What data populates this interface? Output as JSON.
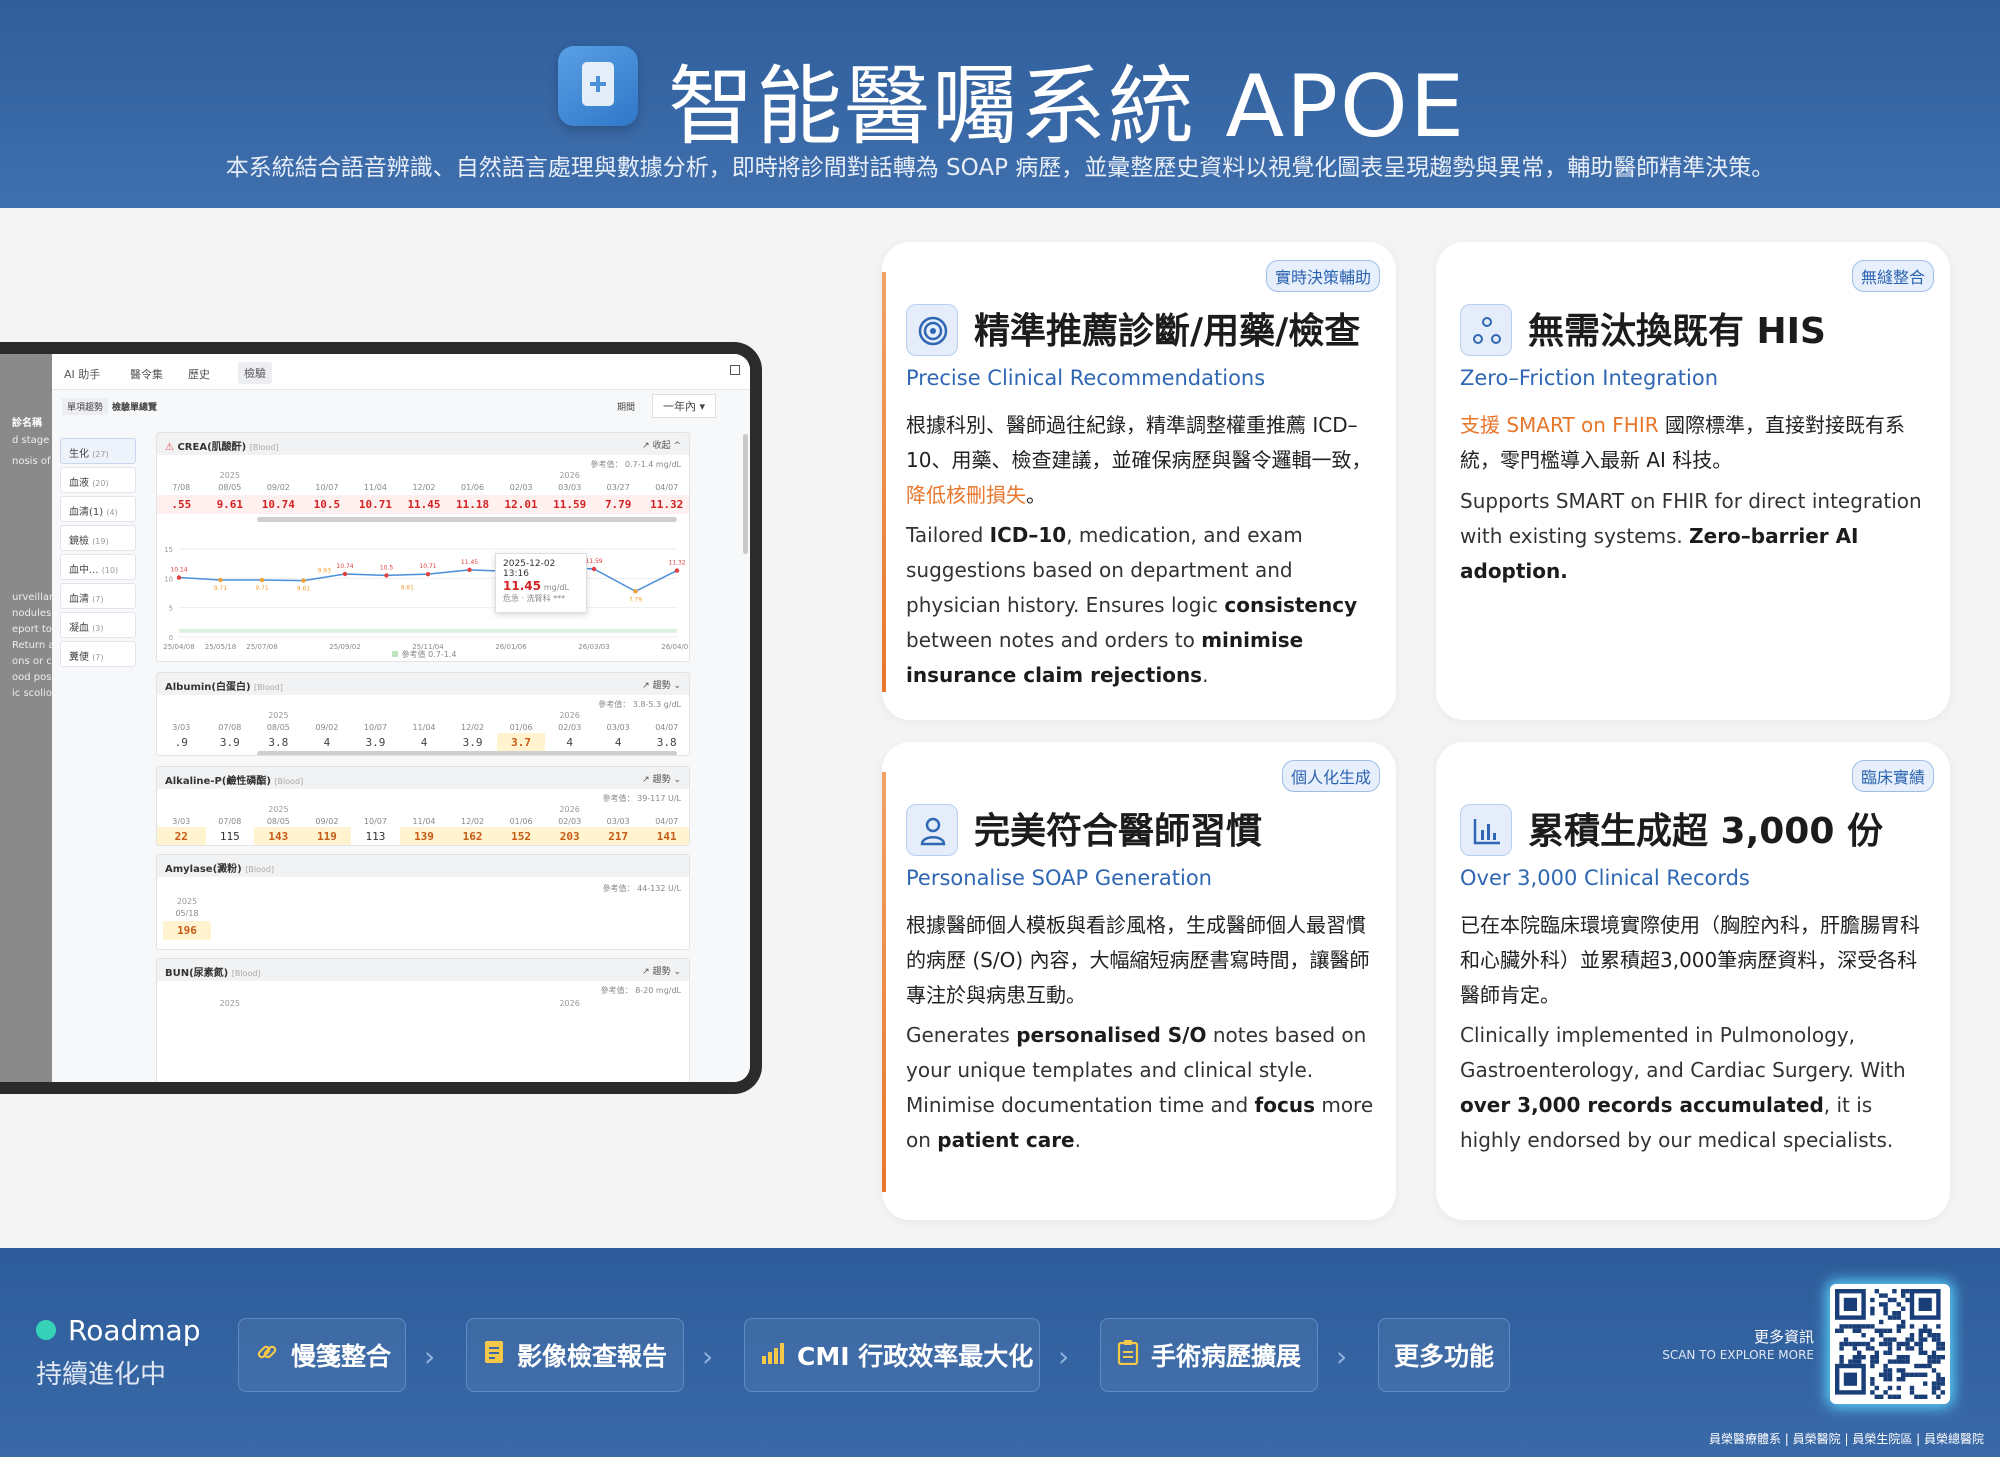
{
  "header": {
    "title": "智能醫囑系統 APOE",
    "subtitle": "本系統結合語音辨識、自然語言處理與數據分析，即時將診間對話轉為 SOAP 病歷，並彙整歷史資料以視覺化圖表呈現趨勢與異常，輔助醫師精準決策。"
  },
  "tablet": {
    "left_pane": {
      "heading": "診名稱",
      "lines_top": [
        "d stage renal dise",
        "nosis of other va"
      ],
      "lines_bottom": [
        "urveillance of",
        "nodules. Formal",
        "eport to be",
        "Return anytime",
        "ons or concerns.",
        "ood posture for",
        "ic scoliosis."
      ]
    },
    "tabs": [
      "AI 助手",
      "醫令集",
      "歷史",
      "檢驗"
    ],
    "subtabs": [
      "單項趨勢",
      "檢驗單總覽"
    ],
    "range_label": "期間",
    "range_value": "一年內",
    "categories": [
      {
        "label": "生化",
        "count": "(27)"
      },
      {
        "label": "血液",
        "count": "(20)"
      },
      {
        "label": "血清(1)",
        "count": "(4)"
      },
      {
        "label": "鏡檢",
        "count": "(19)"
      },
      {
        "label": "血中...",
        "count": "(10)"
      },
      {
        "label": "血清",
        "count": "(7)"
      },
      {
        "label": "凝血",
        "count": "(3)"
      },
      {
        "label": "糞便",
        "count": "(7)"
      }
    ],
    "crea": {
      "name": "CREA(肌酸酐)",
      "specimen": "[Blood]",
      "toggle": "收起",
      "ref": "參考值： 0.7-1.4 mg/dL",
      "years": [
        "2025",
        "2026"
      ],
      "dates": [
        "7/08",
        "08/05",
        "09/02",
        "10/07",
        "11/04",
        "12/02",
        "01/06",
        "02/03",
        "03/03",
        "03/27",
        "04/07"
      ],
      "values": [
        ".55",
        "9.61",
        "10.74",
        "10.5",
        "10.71",
        "11.45",
        "11.18",
        "12.01",
        "11.59",
        "7.79",
        "11.32"
      ],
      "tooltip": {
        "date": "2025-12-02 13:16",
        "value": "11.45",
        "unit": "mg/dL",
        "note": "危急 · 洗腎科 ***"
      },
      "legend": "參考值 0.7-1.4"
    },
    "albumin": {
      "name": "Albumin(白蛋白)",
      "specimen": "[Blood]",
      "toggle": "趨勢",
      "ref": "參考值： 3.8-5.3 g/dL",
      "years": [
        "2025",
        "2026"
      ],
      "dates": [
        "3/03",
        "07/08",
        "08/05",
        "09/02",
        "10/07",
        "11/04",
        "12/02",
        "01/06",
        "02/03",
        "03/03",
        "04/07"
      ],
      "values": [
        ".9",
        "3.9",
        "3.8",
        "4",
        "3.9",
        "4",
        "3.9",
        "3.7",
        "4",
        "4",
        "3.8"
      ]
    },
    "alkp": {
      "name": "Alkaline-P(鹼性磷酯)",
      "specimen": "[Blood]",
      "toggle": "趨勢",
      "ref": "參考值： 39-117 U/L",
      "years": [
        "2025",
        "2026"
      ],
      "dates": [
        "3/03",
        "07/08",
        "08/05",
        "09/02",
        "10/07",
        "11/04",
        "12/02",
        "01/06",
        "02/03",
        "03/03",
        "04/07"
      ],
      "values": [
        "22",
        "115",
        "143",
        "119",
        "113",
        "139",
        "162",
        "152",
        "203",
        "217",
        "141"
      ]
    },
    "amylase": {
      "name": "Amylase(澱粉)",
      "specimen": "[Blood]",
      "ref": "參考值： 44-132 U/L",
      "year": "2025",
      "date": "05/18",
      "value": "196"
    },
    "bun": {
      "name": "BUN(尿素氮)",
      "specimen": "[Blood]",
      "toggle": "趨勢",
      "ref": "參考值： 8-20 mg/dL",
      "years": [
        "2025",
        "2026"
      ]
    }
  },
  "chart_data": {
    "type": "line",
    "title": "CREA(肌酸酐)",
    "x": [
      "25/04/08",
      "25/05/18",
      "25/07/08",
      "25/08/05",
      "25/09/02",
      "25/10/07",
      "25/11/04",
      "25/12/02",
      "26/01/06",
      "26/02/03",
      "26/03/03",
      "26/03/27",
      "26/04/07"
    ],
    "x_tick_labels": [
      "25/04/08",
      "25/05/18",
      "25/07/08",
      "25/09/02",
      "25/11/04",
      "26/01/06",
      "26/03/03",
      "26/04/07"
    ],
    "series": [
      {
        "name": "CREA",
        "values": [
          10.14,
          9.71,
          9.71,
          9.61,
          10.74,
          10.5,
          10.71,
          11.45,
          11.18,
          12.01,
          11.59,
          7.79,
          11.32
        ]
      }
    ],
    "point_labels": [
      "10.14",
      "9.71",
      "9.71",
      "9.61",
      "10.74",
      "10.5",
      "10.71",
      "11.45",
      "11.18",
      "12.01",
      "11.59",
      "7.79",
      "11.32"
    ],
    "extra_labels": [
      "9.93",
      "9.81"
    ],
    "y_ticks": [
      0,
      5,
      10,
      15
    ],
    "ylim": [
      0,
      15
    ],
    "colors": {
      "line": "#4a90d9",
      "high": "#e04040",
      "low": "#f0a030"
    }
  },
  "cards": [
    {
      "badge": "實時決策輔助",
      "icon": "target-icon",
      "title": "精準推薦診斷/用藥/檢查",
      "subtitle": "Precise Clinical Recommendations",
      "zh_1": "根據科別、醫師過往紀錄，精準調整權重推薦 ICD–10、用藥、檢查建議，並確保病歷與醫令邏輯一致，",
      "zh_hl": "降低核刪損失",
      "zh_2": "。",
      "en_1": "Tailored ",
      "en_b1": "ICD–10",
      "en_2": ", medication, and exam suggestions based on department and physician history. Ensures logic ",
      "en_b2": "consistency",
      "en_3": " between notes and orders to ",
      "en_b3": "minimise insurance claim rejections",
      "en_4": "."
    },
    {
      "badge": "無縫整合",
      "icon": "network-icon",
      "title": "無需汰換既有 HIS",
      "subtitle": "Zero–Friction Integration",
      "zh_hl": "支援 SMART on FHIR",
      "zh_1": " 國際標準，直接對接既有系統，零門檻導入最新 AI 科技。",
      "en_1": "Supports SMART on FHIR for direct integration with existing systems. ",
      "en_b1": "Zero–barrier AI adoption."
    },
    {
      "badge": "個人化生成",
      "icon": "user-icon",
      "title": "完美符合醫師習慣",
      "subtitle": "Personalise SOAP Generation",
      "zh_1": "根據醫師個人模板與看診風格，生成醫師個人最習慣的病歷 (S/O) 內容，大幅縮短病歷書寫時間，讓醫師專注於與病患互動。",
      "en_1": "Generates ",
      "en_b1": "personalised S/O",
      "en_2": " notes based on your unique templates and clinical style. Minimise documentation time and ",
      "en_b2": "focus",
      "en_3": " more on ",
      "en_b3": "patient care",
      "en_4": "."
    },
    {
      "badge": "臨床實績",
      "icon": "bar-chart-icon",
      "title": "累積生成超 3,000 份",
      "subtitle": "Over 3,000 Clinical Records",
      "zh_1": "已在本院臨床環境實際使用（胸腔內科，肝膽腸胃科和心臟外科）並累積超3,000筆病歷資料，深受各科醫師肯定。",
      "en_1": "Clinically implemented in Pulmonology, Gastroenterology, and Cardiac Surgery. With ",
      "en_b1": "over 3,000 records accumulated",
      "en_2": ", it is highly endorsed by our medical specialists."
    }
  ],
  "footer": {
    "roadmap_title": "Roadmap",
    "roadmap_sub": "持續進化中",
    "items": [
      "慢箋整合",
      "影像檢查報告",
      "CMI 行政效率最大化",
      "手術病歷擴展",
      "更多功能"
    ],
    "more_zh": "更多資訊",
    "more_en": "SCAN TO EXPLORE MORE",
    "credit": "員榮醫療體系 | 員榮醫院 | 員榮生院區 | 員榮總醫院"
  }
}
